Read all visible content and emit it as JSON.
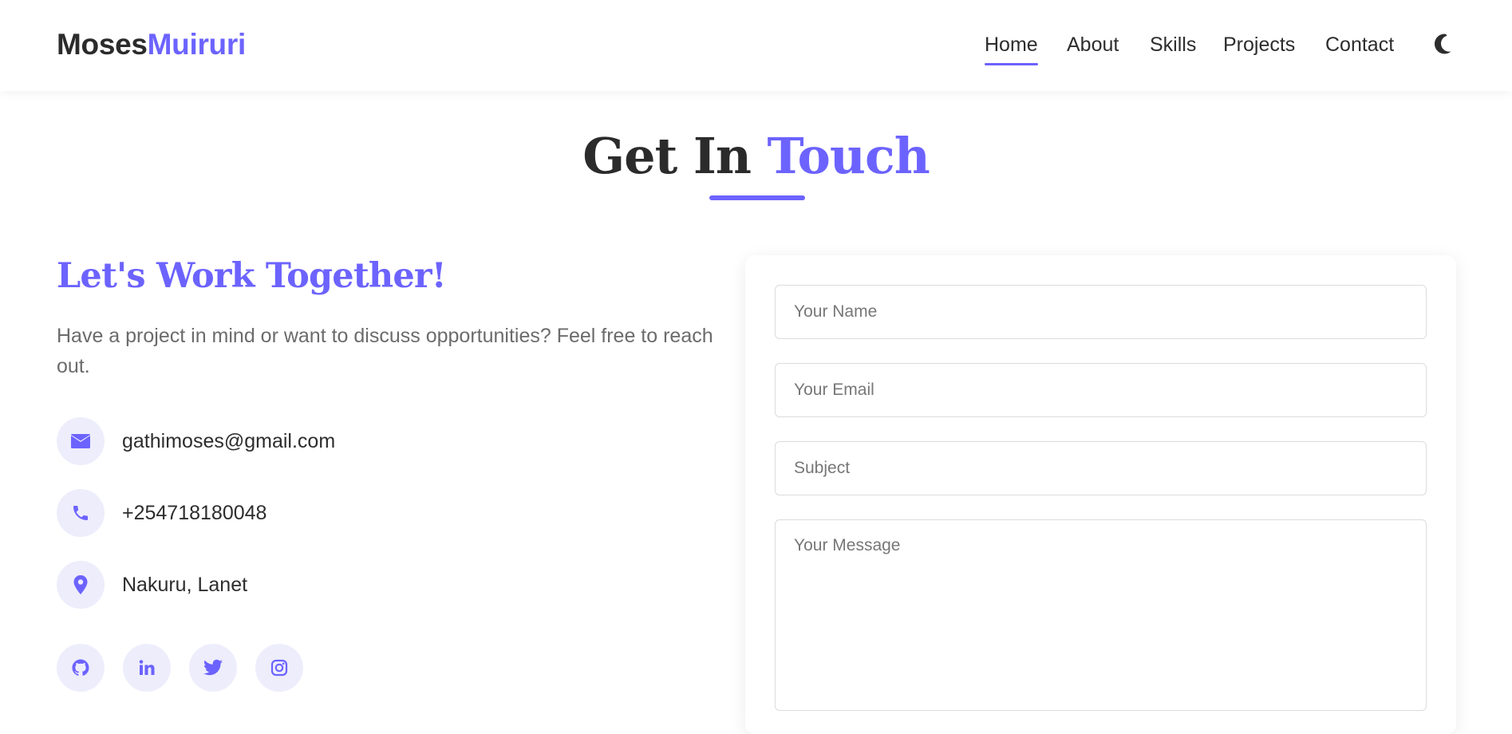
{
  "header": {
    "logo_first": "Moses",
    "logo_last": "Muiruri",
    "nav": [
      {
        "label": "Home",
        "active": true
      },
      {
        "label": "About",
        "active": false
      },
      {
        "label": "Skills",
        "active": false
      },
      {
        "label": "Projects",
        "active": false
      },
      {
        "label": "Contact",
        "active": false
      }
    ],
    "theme_icon": "moon-icon"
  },
  "section": {
    "title_main": "Get In ",
    "title_accent": "Touch"
  },
  "contact": {
    "heading": "Let's Work Together!",
    "intro": "Have a project in mind or want to discuss opportunities? Feel free to reach out.",
    "items": [
      {
        "icon": "envelope-icon",
        "text": "gathimoses@gmail.com"
      },
      {
        "icon": "phone-icon",
        "text": "+254718180048"
      },
      {
        "icon": "location-pin-icon",
        "text": "Nakuru, Lanet"
      }
    ],
    "socials": [
      "github-icon",
      "linkedin-icon",
      "twitter-icon",
      "instagram-icon"
    ]
  },
  "form": {
    "name_placeholder": "Your Name",
    "email_placeholder": "Your Email",
    "subject_placeholder": "Subject",
    "message_placeholder": "Your Message",
    "name_value": "",
    "email_value": "",
    "subject_value": "",
    "message_value": ""
  },
  "colors": {
    "accent": "#6c63ff",
    "text": "#2d2d2d",
    "muted": "#6b6b6b",
    "icon_bg": "#eeedfc"
  }
}
